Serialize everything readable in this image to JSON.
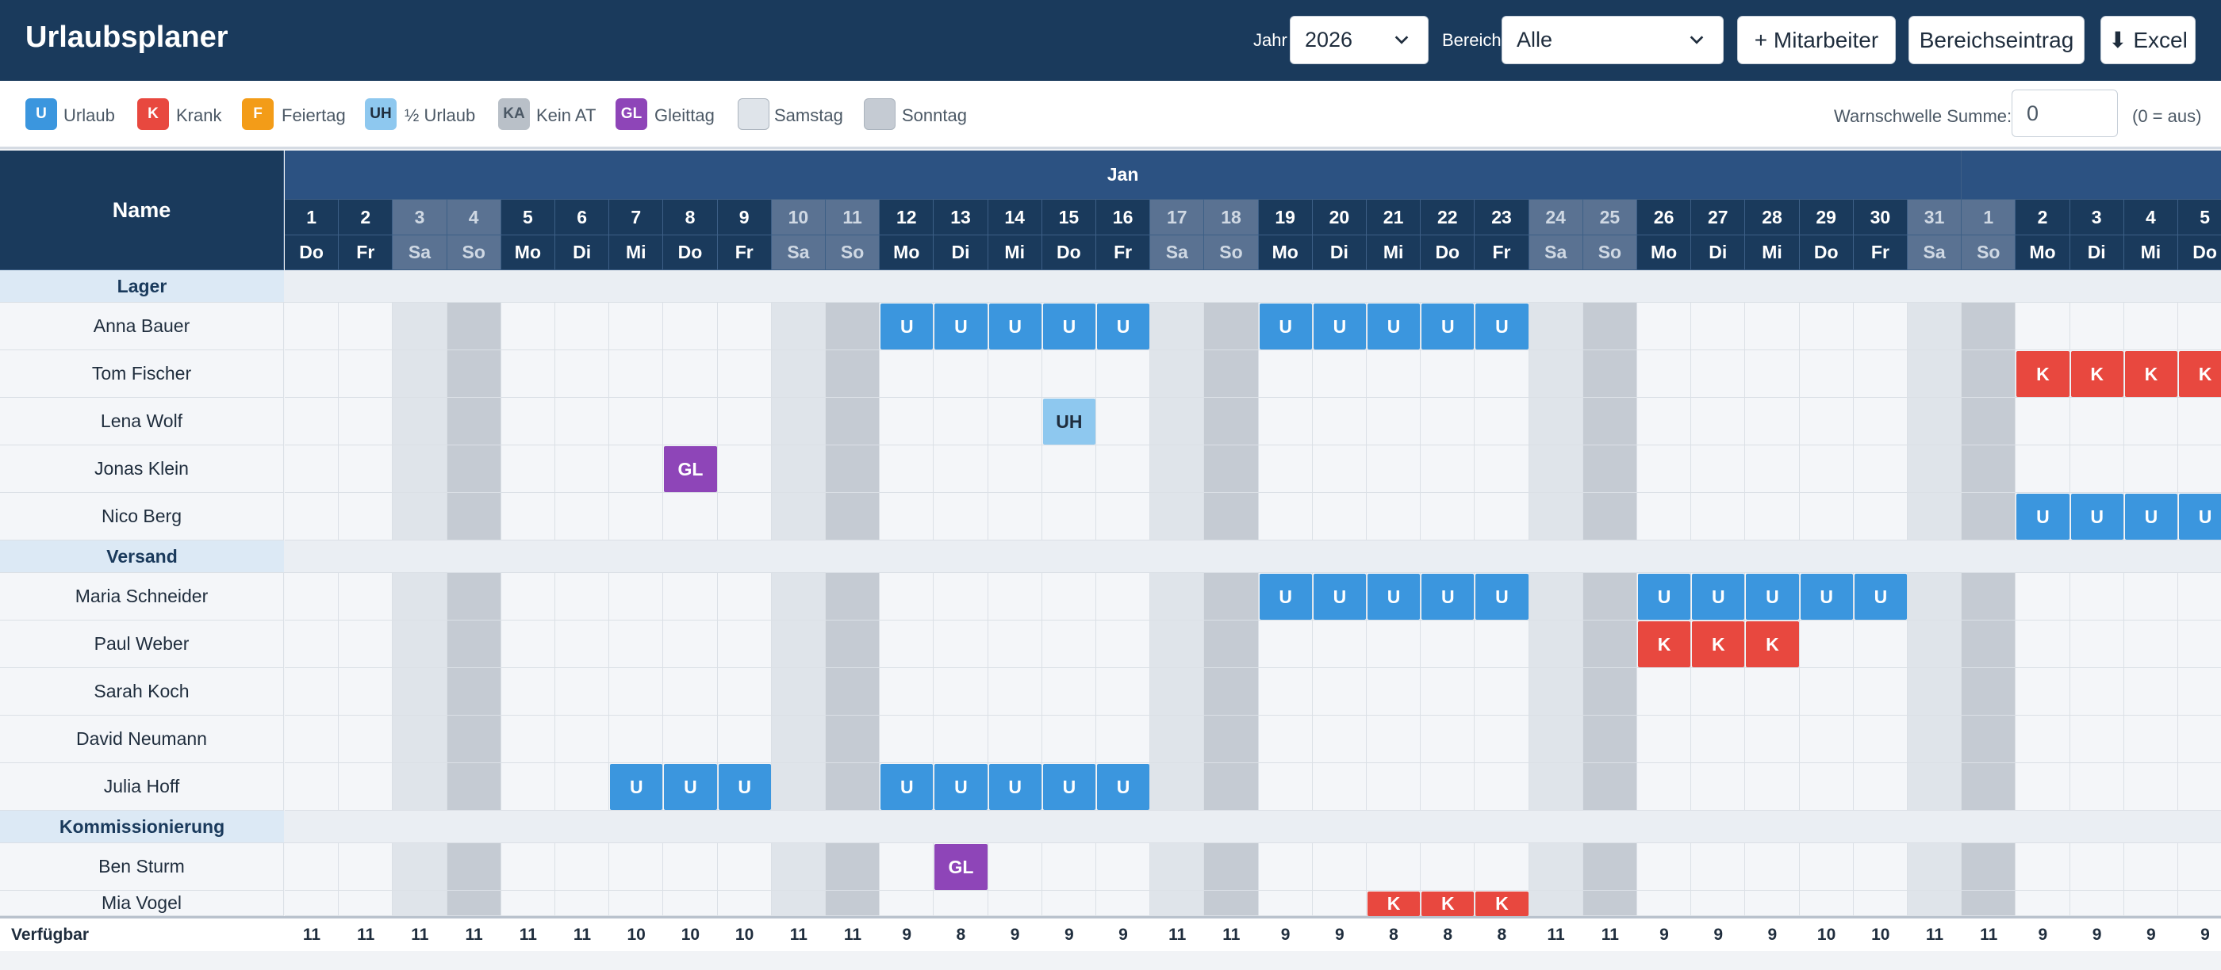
{
  "app": {
    "title": "Urlaubsplaner"
  },
  "toolbar": {
    "year_label": "Jahr",
    "year_value": "2026",
    "area_label": "Bereich",
    "area_value": "Alle",
    "add_employee_label": "+ Mitarbeiter",
    "area_entry_label": "Bereichseintrag",
    "excel_label": "⬇ Excel"
  },
  "legend": {
    "items": [
      {
        "code": "U",
        "label": "Urlaub",
        "color": "#3b96de",
        "text_color": "#ffffff"
      },
      {
        "code": "K",
        "label": "Krank",
        "color": "#e8483f",
        "text_color": "#ffffff"
      },
      {
        "code": "F",
        "label": "Feiertag",
        "color": "#f39c18",
        "text_color": "#ffffff"
      },
      {
        "code": "UH",
        "label": "½ Urlaub",
        "color": "#8ec8ef",
        "text_color": "#1f2d3d"
      },
      {
        "code": "KA",
        "label": "Kein AT",
        "color": "#b9c0c8",
        "text_color": "#4b5865"
      },
      {
        "code": "GL",
        "label": "Gleittag",
        "color": "#8e45b8",
        "text_color": "#ffffff"
      },
      {
        "code": "",
        "label": "Samstag",
        "color": "#dfe4ea",
        "text_color": "#1f2d3d"
      },
      {
        "code": "",
        "label": "Sonntag",
        "color": "#c5cbd3",
        "text_color": "#1f2d3d"
      }
    ],
    "warn_label": "Warnschwelle Summe:",
    "warn_value": "0",
    "warn_hint": "(0 = aus)"
  },
  "colors": {
    "header_bg": "#1a3a5c",
    "header_row": "#1a3a5c",
    "weekend_header": "#5a7292",
    "saturday_bg": "#dfe4ea",
    "sunday_bg": "#c5cbd3",
    "cell_bg": "#f4f6f9"
  },
  "table": {
    "name_header": "Name",
    "months": [
      {
        "label": "Jan",
        "start": 0,
        "span": 31
      },
      {
        "label": "",
        "start": 31,
        "span": 5
      }
    ],
    "days": [
      {
        "num": "1",
        "wd": "Do"
      },
      {
        "num": "2",
        "wd": "Fr"
      },
      {
        "num": "3",
        "wd": "Sa"
      },
      {
        "num": "4",
        "wd": "So"
      },
      {
        "num": "5",
        "wd": "Mo"
      },
      {
        "num": "6",
        "wd": "Di"
      },
      {
        "num": "7",
        "wd": "Mi"
      },
      {
        "num": "8",
        "wd": "Do"
      },
      {
        "num": "9",
        "wd": "Fr"
      },
      {
        "num": "10",
        "wd": "Sa"
      },
      {
        "num": "11",
        "wd": "So"
      },
      {
        "num": "12",
        "wd": "Mo"
      },
      {
        "num": "13",
        "wd": "Di"
      },
      {
        "num": "14",
        "wd": "Mi"
      },
      {
        "num": "15",
        "wd": "Do"
      },
      {
        "num": "16",
        "wd": "Fr"
      },
      {
        "num": "17",
        "wd": "Sa"
      },
      {
        "num": "18",
        "wd": "So"
      },
      {
        "num": "19",
        "wd": "Mo"
      },
      {
        "num": "20",
        "wd": "Di"
      },
      {
        "num": "21",
        "wd": "Mi"
      },
      {
        "num": "22",
        "wd": "Do"
      },
      {
        "num": "23",
        "wd": "Fr"
      },
      {
        "num": "24",
        "wd": "Sa"
      },
      {
        "num": "25",
        "wd": "So"
      },
      {
        "num": "26",
        "wd": "Mo"
      },
      {
        "num": "27",
        "wd": "Di"
      },
      {
        "num": "28",
        "wd": "Mi"
      },
      {
        "num": "29",
        "wd": "Do"
      },
      {
        "num": "30",
        "wd": "Fr"
      },
      {
        "num": "31",
        "wd": "Sa"
      },
      {
        "num": "1",
        "wd": "So"
      },
      {
        "num": "2",
        "wd": "Mo"
      },
      {
        "num": "3",
        "wd": "Di"
      },
      {
        "num": "4",
        "wd": "Mi"
      },
      {
        "num": "5",
        "wd": "Do"
      }
    ],
    "rows": [
      {
        "type": "group",
        "label": "Lager"
      },
      {
        "type": "emp",
        "name": "Anna Bauer",
        "marks": {
          "11": "U",
          "12": "U",
          "13": "U",
          "14": "U",
          "15": "U",
          "18": "U",
          "19": "U",
          "20": "U",
          "21": "U",
          "22": "U"
        }
      },
      {
        "type": "emp",
        "name": "Tom Fischer",
        "marks": {
          "32": "K",
          "33": "K",
          "34": "K",
          "35": "K"
        }
      },
      {
        "type": "emp",
        "name": "Lena Wolf",
        "marks": {
          "14": "UH"
        }
      },
      {
        "type": "emp",
        "name": "Jonas Klein",
        "marks": {
          "7": "GL"
        }
      },
      {
        "type": "emp",
        "name": "Nico Berg",
        "marks": {
          "32": "U",
          "33": "U",
          "34": "U",
          "35": "U"
        }
      },
      {
        "type": "group",
        "label": "Versand"
      },
      {
        "type": "emp",
        "name": "Maria Schneider",
        "marks": {
          "18": "U",
          "19": "U",
          "20": "U",
          "21": "U",
          "22": "U",
          "25": "U",
          "26": "U",
          "27": "U",
          "28": "U",
          "29": "U"
        }
      },
      {
        "type": "emp",
        "name": "Paul Weber",
        "marks": {
          "25": "K",
          "26": "K",
          "27": "K"
        }
      },
      {
        "type": "emp",
        "name": "Sarah Koch",
        "marks": {}
      },
      {
        "type": "emp",
        "name": "David Neumann",
        "marks": {}
      },
      {
        "type": "emp",
        "name": "Julia Hoff",
        "marks": {
          "6": "U",
          "7": "U",
          "8": "U",
          "11": "U",
          "12": "U",
          "13": "U",
          "14": "U",
          "15": "U"
        }
      },
      {
        "type": "group",
        "label": "Kommissionierung"
      },
      {
        "type": "emp",
        "name": "Ben Sturm",
        "marks": {
          "12": "GL"
        }
      },
      {
        "type": "emp",
        "name": "Mia Vogel",
        "marks": {
          "20": "K",
          "21": "K",
          "22": "K"
        }
      }
    ],
    "footer_label": "Verfügbar",
    "footer_values": [
      "11",
      "11",
      "11",
      "11",
      "11",
      "11",
      "10",
      "10",
      "10",
      "11",
      "11",
      "9",
      "8",
      "9",
      "9",
      "9",
      "11",
      "11",
      "9",
      "9",
      "8",
      "8",
      "8",
      "11",
      "11",
      "9",
      "9",
      "9",
      "10",
      "10",
      "11",
      "11",
      "9",
      "9",
      "9",
      "9"
    ]
  }
}
